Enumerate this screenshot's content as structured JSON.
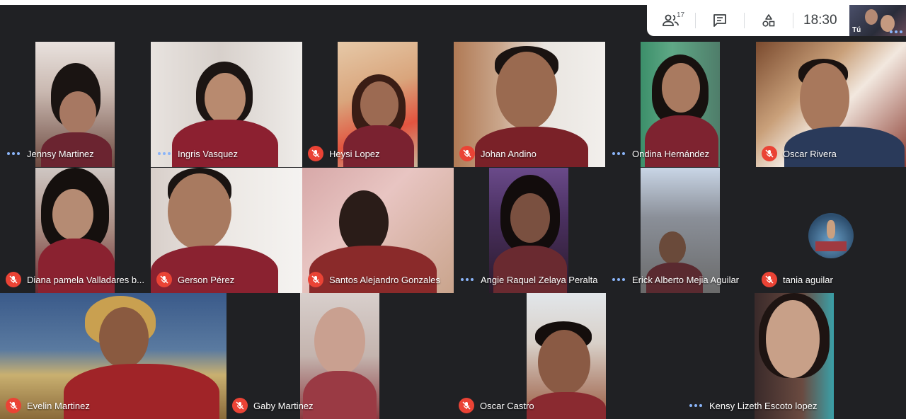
{
  "toolbar": {
    "participants_count": "17",
    "time": "18:30",
    "self_label": "Tú"
  },
  "participants": [
    {
      "name": "Jennsy Martinez",
      "muted": false
    },
    {
      "name": "Ingris Vasquez",
      "muted": false
    },
    {
      "name": "Heysi Lopez",
      "muted": true
    },
    {
      "name": "Johan Andino",
      "muted": true
    },
    {
      "name": "Ondina Hernández",
      "muted": false
    },
    {
      "name": "Oscar Rivera",
      "muted": true
    },
    {
      "name": "Diana pamela Valladares b...",
      "muted": true
    },
    {
      "name": "Gerson Pérez",
      "muted": true
    },
    {
      "name": "Santos Alejandro Gonzales",
      "muted": true
    },
    {
      "name": "Angie Raquel Zelaya Peralta",
      "muted": false
    },
    {
      "name": "Erick Alberto Mejia Aguilar",
      "muted": false
    },
    {
      "name": "tania aguilar",
      "muted": true
    },
    {
      "name": "Evelin Martinez",
      "muted": true
    },
    {
      "name": "Gaby Martinez",
      "muted": true
    },
    {
      "name": "Oscar Castro",
      "muted": true
    },
    {
      "name": "Kensy Lizeth Escoto lopez",
      "muted": false
    }
  ],
  "colors": {
    "background": "#202124",
    "mic_off": "#ea4335",
    "speaking_bar": "#4ecde6",
    "dots": "#8ab4f8"
  }
}
